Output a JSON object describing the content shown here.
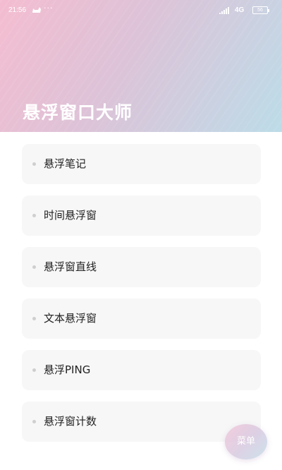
{
  "status_bar": {
    "time": "21:56",
    "notification_icon": "cat-icon",
    "more_dots": "···",
    "signal_icon": "signal-icon",
    "network": "4G",
    "battery": "56"
  },
  "header": {
    "title": "悬浮窗口大师"
  },
  "menu": {
    "items": [
      {
        "label": "悬浮笔记"
      },
      {
        "label": "时间悬浮窗"
      },
      {
        "label": "悬浮窗直线"
      },
      {
        "label": "文本悬浮窗"
      },
      {
        "label": "悬浮PING"
      },
      {
        "label": "悬浮窗计数"
      }
    ]
  },
  "fab": {
    "label": "菜单"
  },
  "colors": {
    "header_gradient_start": "#f4bcd0",
    "header_gradient_end": "#bcdce8",
    "card_background": "#f7f7f7",
    "text_primary": "#222222"
  }
}
